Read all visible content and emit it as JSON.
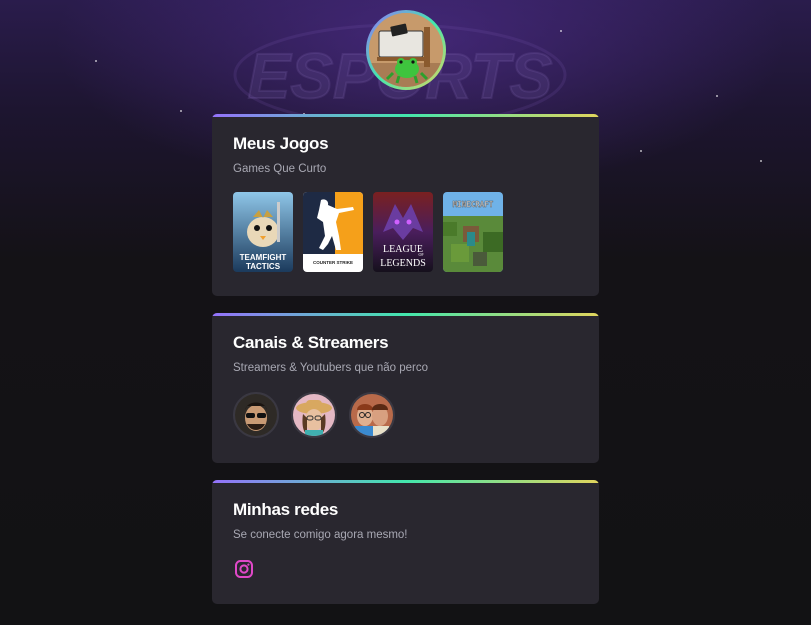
{
  "profile": {
    "avatar": "profile-avatar-frog-at-desk"
  },
  "sections": {
    "games": {
      "title": "Meus Jogos",
      "subtitle": "Games Que Curto",
      "items": [
        {
          "name": "Teamfight Tactics",
          "line1": "TEAMFIGHT",
          "line2": "TACTICS"
        },
        {
          "name": "Counter-Strike",
          "line1": "COUNTER STRIKE"
        },
        {
          "name": "League of Legends",
          "line1": "LEAGUE",
          "line2": "OF",
          "line3": "LEGENDS"
        },
        {
          "name": "Minecraft",
          "line1": "MINECRAFT"
        }
      ]
    },
    "streamers": {
      "title": "Canais & Streamers",
      "subtitle": "Streamers & Youtubers que não perco"
    },
    "socials": {
      "title": "Minhas redes",
      "subtitle": "Se conecte comigo agora mesmo!",
      "instagram_color": "#e048c8"
    }
  },
  "colors": {
    "background": "#121214",
    "card": "#29272f",
    "gradient_start": "#9572fc",
    "gradient_mid": "#43e7ad",
    "gradient_end": "#e1d55d"
  }
}
